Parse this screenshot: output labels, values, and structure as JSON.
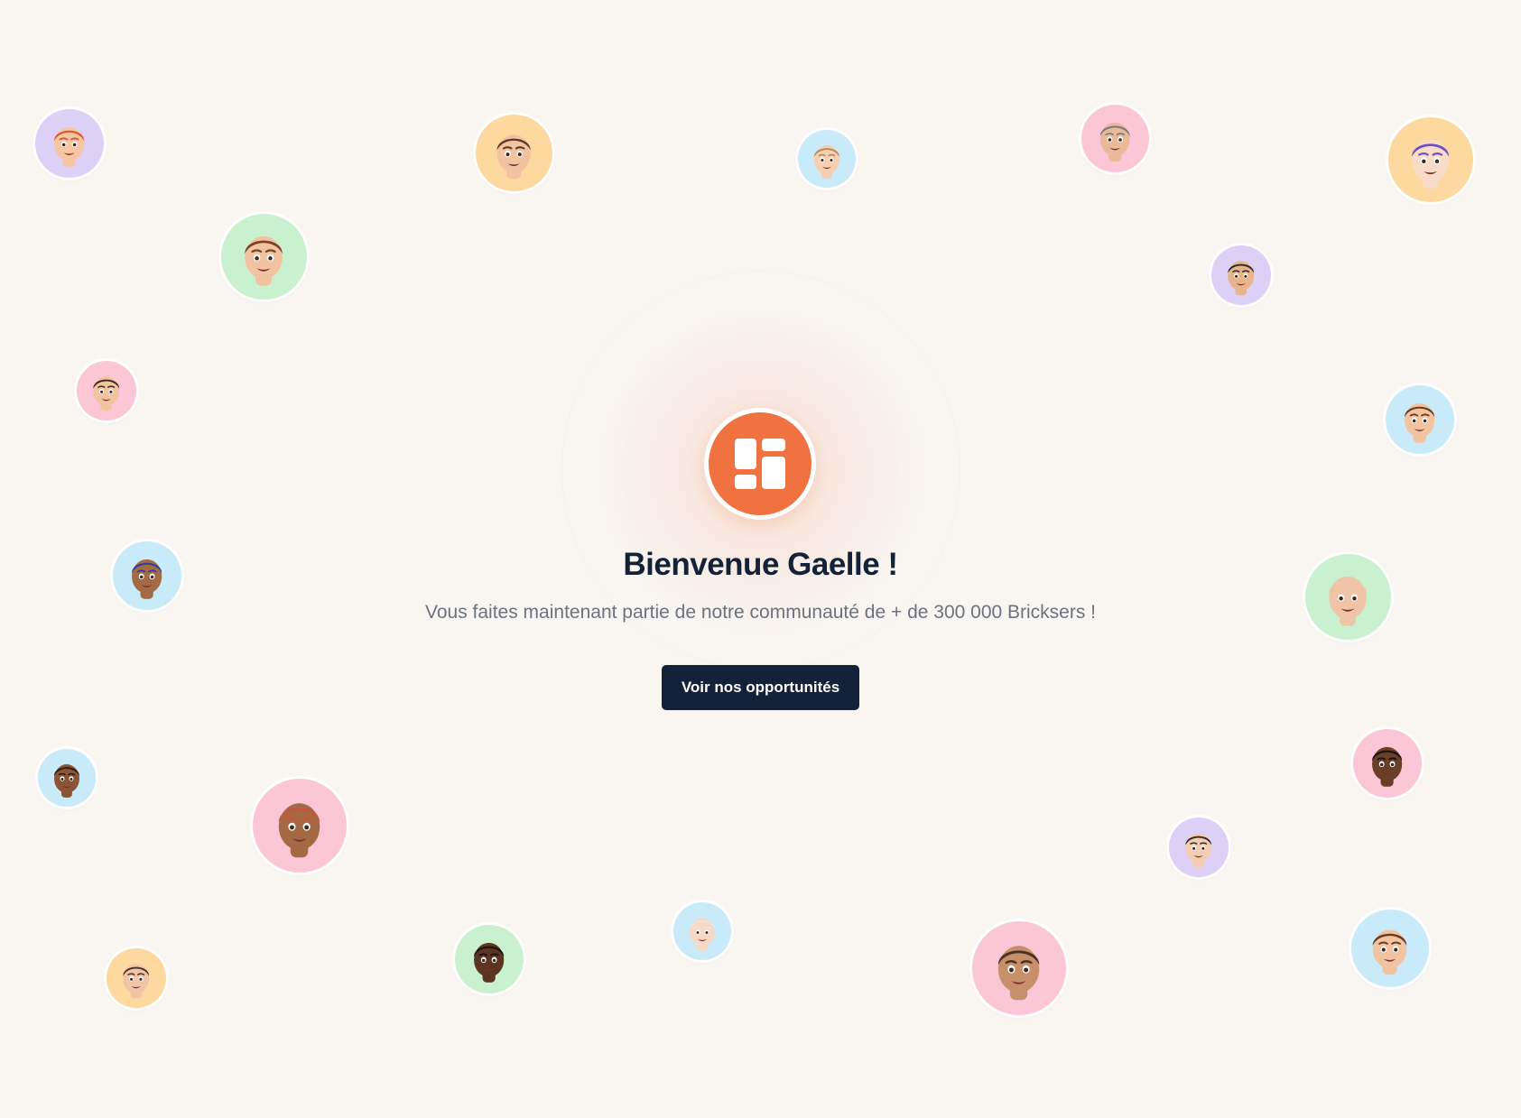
{
  "colors": {
    "background": "#f9f6f2",
    "brand_orange": "#f07241",
    "button_navy": "#132238",
    "title_color": "#132238",
    "subtitle_color": "#6b7280"
  },
  "welcome": {
    "title": "Bienvenue Gaelle !",
    "subtitle": "Vous faites maintenant partie de notre communauté de + de 300 000 Bricksers !",
    "cta_label": "Voir nos opportunités",
    "logo_icon": "brand-dashboard-icon"
  },
  "avatars": [
    {
      "name": "avatar-memoji",
      "bg": "#dcd0f7",
      "skin": "#f6c6a4",
      "hair": "#d9542a"
    },
    {
      "name": "avatar-memoji",
      "bg": "#fdd9a0",
      "skin": "#f2c3a0",
      "hair": "#5a3a26"
    },
    {
      "name": "avatar-memoji",
      "bg": "#c9ebf9",
      "skin": "#f6cfb0",
      "hair": "#b7835a"
    },
    {
      "name": "avatar-memoji",
      "bg": "#fbc7d6",
      "skin": "#e9b99a",
      "hair": "#7a7a7a"
    },
    {
      "name": "avatar-memoji",
      "bg": "#fdd9a0",
      "skin": "#f8dcc8",
      "hair": "#6a4fc2"
    },
    {
      "name": "avatar-memoji",
      "bg": "#c9f0cf",
      "skin": "#f2c3a0",
      "hair": "#7a4424"
    },
    {
      "name": "avatar-memoji",
      "bg": "#dcd0f7",
      "skin": "#e8b48c",
      "hair": "#2a2a2a"
    },
    {
      "name": "avatar-memoji",
      "bg": "#fbc7d6",
      "skin": "#f2c3a0",
      "hair": "#3a2a20"
    },
    {
      "name": "avatar-memoji",
      "bg": "#c9ebf9",
      "skin": "#f2c3a0",
      "hair": "#6a3a20"
    },
    {
      "name": "avatar-memoji",
      "bg": "#c9ebf9",
      "skin": "#a36a45",
      "hair": "#2d3e9c"
    },
    {
      "name": "avatar-memoji",
      "bg": "#c9f0cf",
      "skin": "#f0c4a6",
      "hair": "#f0c4a6"
    },
    {
      "name": "avatar-memoji",
      "bg": "#c9ebf9",
      "skin": "#8a5536",
      "hair": "#2a1a12"
    },
    {
      "name": "avatar-memoji",
      "bg": "#fbc7d6",
      "skin": "#a46a45",
      "hair": "#c8563a"
    },
    {
      "name": "avatar-memoji",
      "bg": "#fbc7d6",
      "skin": "#6a3f28",
      "hair": "#1a1210"
    },
    {
      "name": "avatar-memoji",
      "bg": "#dcd0f7",
      "skin": "#f2cdb2",
      "hair": "#3a2a20"
    },
    {
      "name": "avatar-memoji",
      "bg": "#fdd9a0",
      "skin": "#f0c4a6",
      "hair": "#4a3224"
    },
    {
      "name": "avatar-memoji",
      "bg": "#c9f0cf",
      "skin": "#5a3522",
      "hair": "#1a1210"
    },
    {
      "name": "avatar-memoji",
      "bg": "#c9ebf9",
      "skin": "#f6d8c4",
      "hair": "#e6e6e6"
    },
    {
      "name": "avatar-memoji",
      "bg": "#fbc7d6",
      "skin": "#c8906a",
      "hair": "#4a3224"
    },
    {
      "name": "avatar-memoji",
      "bg": "#c9ebf9",
      "skin": "#f2c3a0",
      "hair": "#6a3a20"
    }
  ]
}
